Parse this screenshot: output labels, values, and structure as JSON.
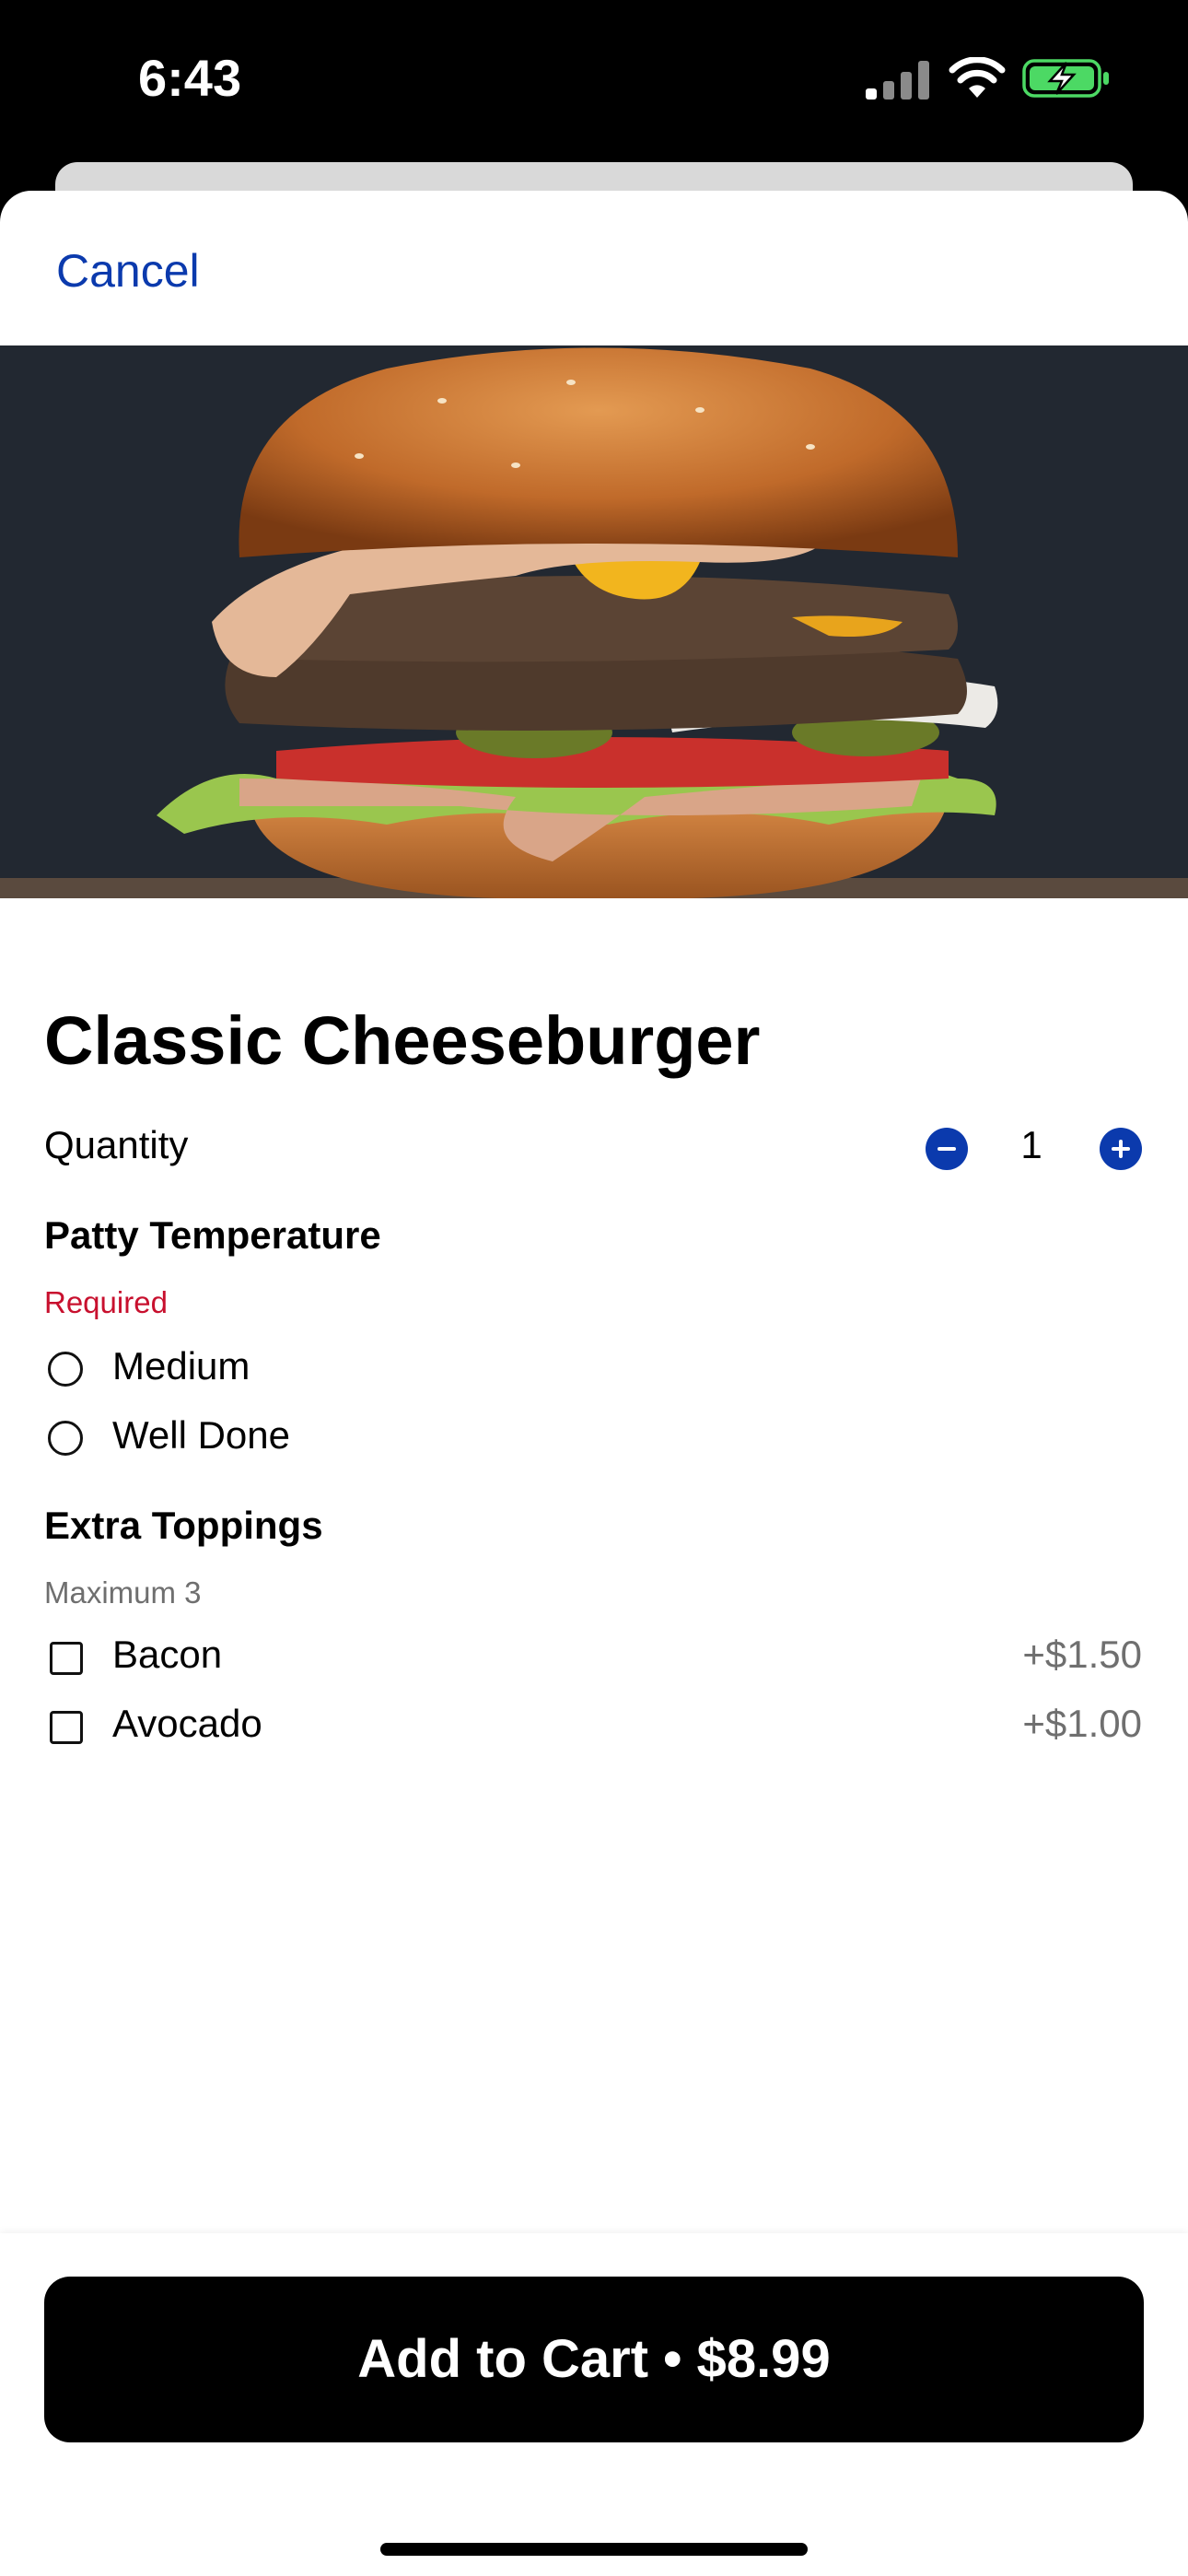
{
  "status_bar": {
    "time": "6:43"
  },
  "header": {
    "cancel_label": "Cancel"
  },
  "item": {
    "title": "Classic Cheeseburger",
    "quantity_label": "Quantity",
    "quantity_value": "1"
  },
  "patty_temperature": {
    "title": "Patty Temperature",
    "note": "Required",
    "options": [
      {
        "label": "Medium"
      },
      {
        "label": "Well Done"
      }
    ]
  },
  "extra_toppings": {
    "title": "Extra Toppings",
    "note": "Maximum 3",
    "options": [
      {
        "label": "Bacon",
        "price": "+$1.50"
      },
      {
        "label": "Avocado",
        "price": "+$1.00"
      }
    ]
  },
  "footer": {
    "cta_label": "Add to Cart • $8.99"
  },
  "colors": {
    "accent": "#0b3aad",
    "required": "#c8102e",
    "button": "#000000"
  }
}
